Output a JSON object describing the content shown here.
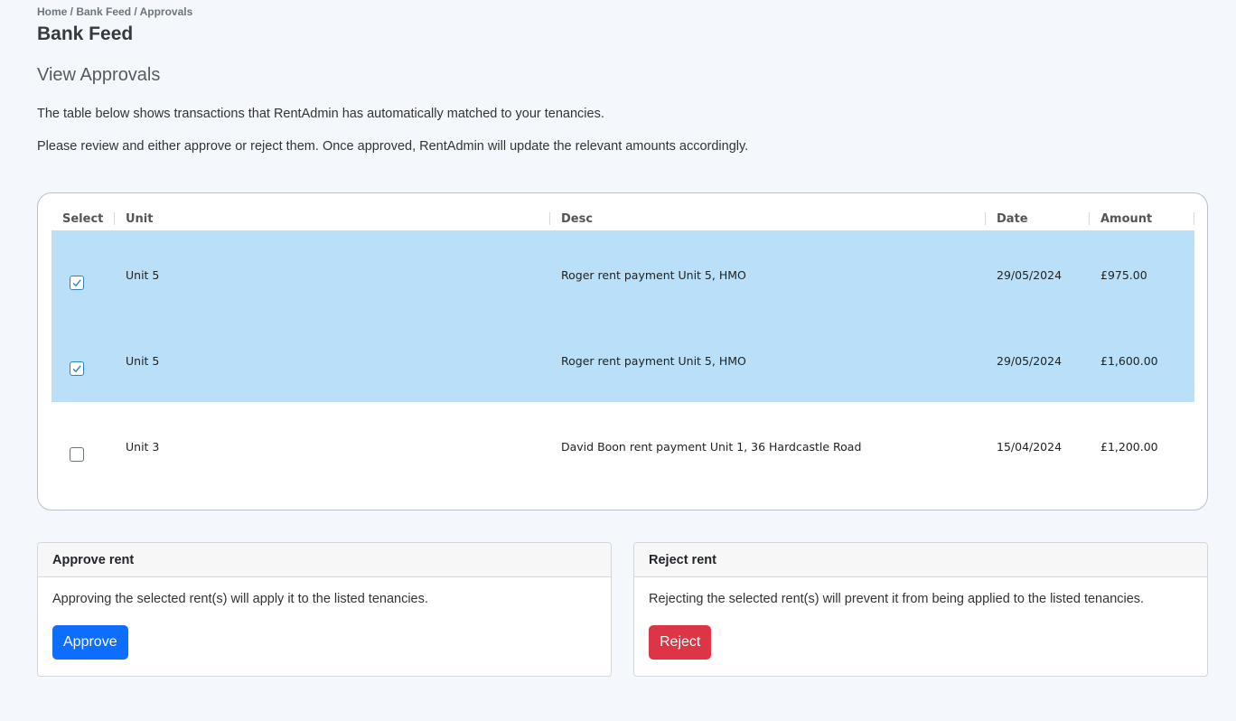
{
  "breadcrumb": "Home / Bank Feed / Approvals",
  "page_title": "Bank Feed",
  "section_title": "View Approvals",
  "intro": {
    "line1": "The table below shows transactions that RentAdmin has automatically matched to your tenancies.",
    "line2": "Please review and either approve or reject them. Once approved, RentAdmin will update the relevant amounts accordingly."
  },
  "table": {
    "columns": [
      "Select",
      "Unit",
      "Desc",
      "Date",
      "Amount"
    ],
    "rows": [
      {
        "selected": true,
        "unit": "Unit 5",
        "desc": "Roger rent payment Unit 5, HMO",
        "date": "29/05/2024",
        "amount": "£975.00"
      },
      {
        "selected": true,
        "unit": "Unit 5",
        "desc": "Roger rent payment Unit 5, HMO",
        "date": "29/05/2024",
        "amount": "£1,600.00"
      },
      {
        "selected": false,
        "unit": "Unit 3",
        "desc": "David Boon rent payment Unit 1, 36 Hardcastle Road",
        "date": "15/04/2024",
        "amount": "£1,200.00"
      }
    ]
  },
  "approve_card": {
    "title": "Approve rent",
    "text": "Approving the selected rent(s) will apply it to the listed tenancies.",
    "button": "Approve"
  },
  "reject_card": {
    "title": "Reject rent",
    "text": "Rejecting the selected rent(s) will prevent it from being applied to the listed tenancies.",
    "button": "Reject"
  },
  "colors": {
    "selected_row": "#b9e0f8",
    "approve": "#0d6efd",
    "reject": "#dc3545"
  }
}
